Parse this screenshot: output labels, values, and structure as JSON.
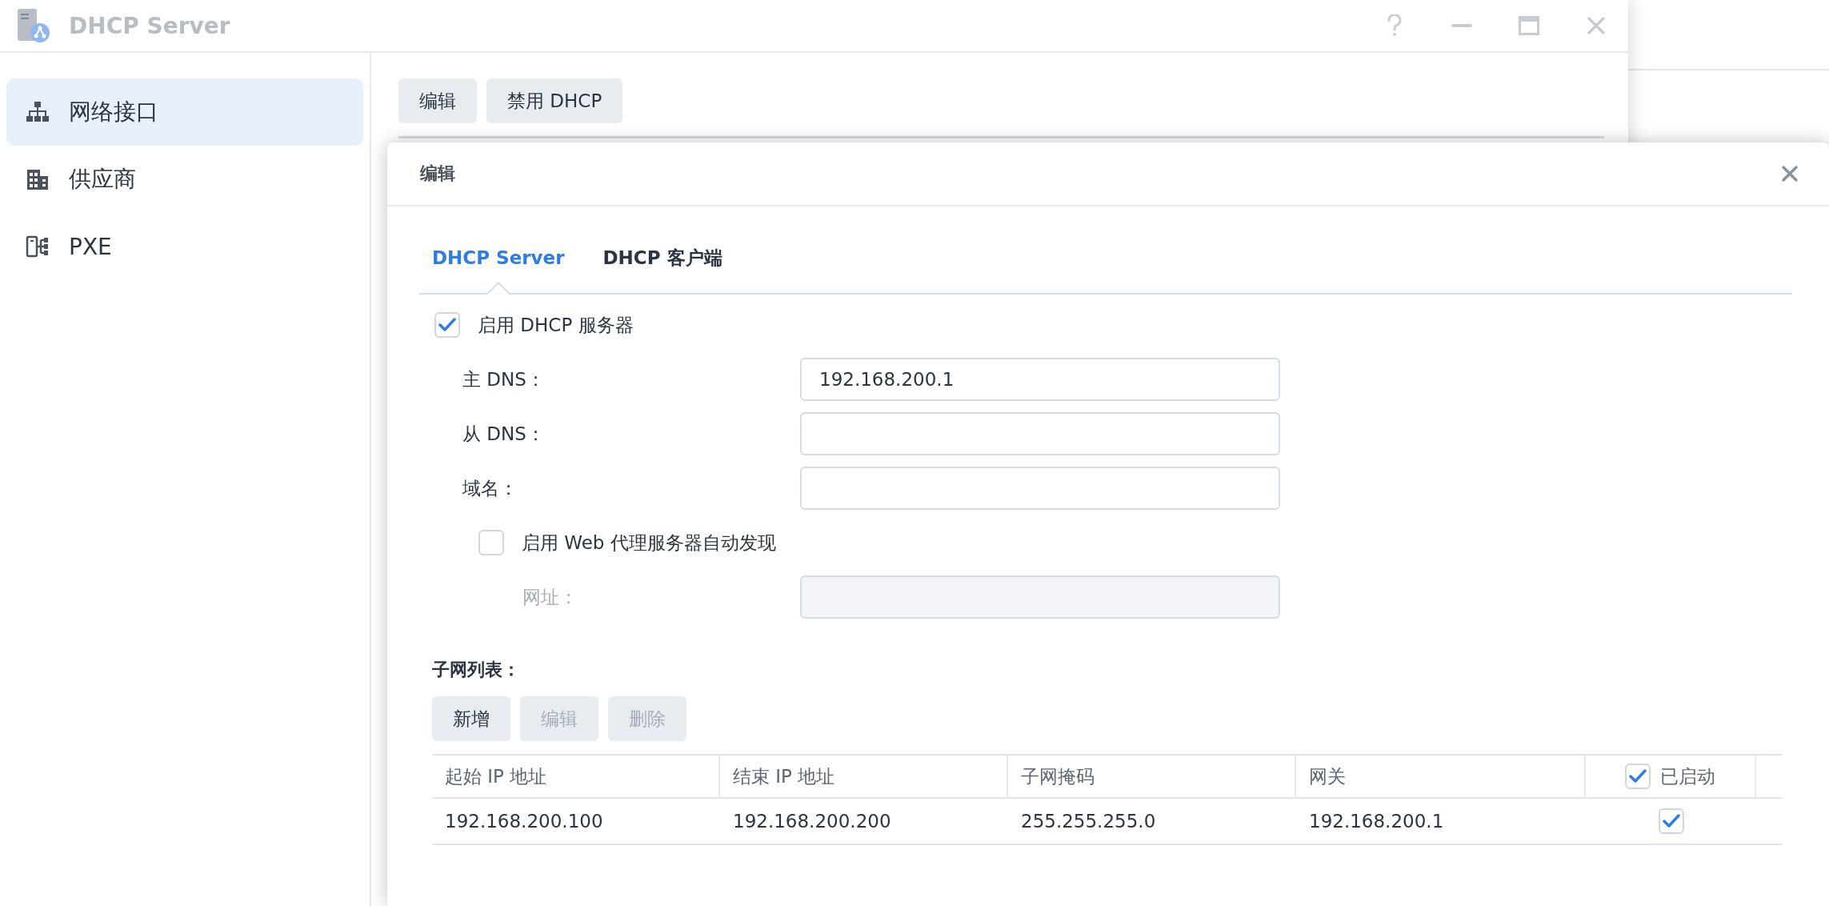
{
  "window": {
    "title": "DHCP Server"
  },
  "sidebar": {
    "items": [
      {
        "label": "网络接口",
        "selected": true
      },
      {
        "label": "供应商",
        "selected": false
      },
      {
        "label": "PXE",
        "selected": false
      }
    ]
  },
  "toolbar": {
    "buttons": [
      "编辑",
      "禁用 DHCP"
    ]
  },
  "dialog": {
    "title": "编辑",
    "tabs": [
      {
        "label": "DHCP Server",
        "selected": true
      },
      {
        "label": "DHCP 客户端",
        "selected": false
      }
    ],
    "enable_server": {
      "label": "启用 DHCP 服务器",
      "checked": true
    },
    "fields": [
      {
        "label": "主 DNS：",
        "value": "192.168.200.1"
      },
      {
        "label": "从 DNS："
      },
      {
        "label": "域名："
      }
    ],
    "proxy": {
      "label": "启用 Web 代理服务器自动发现",
      "checked": false
    },
    "url_field": {
      "label": "网址：",
      "disabled": true
    },
    "subnet": {
      "title": "子网列表：",
      "buttons": [
        {
          "label": "新增",
          "disabled": false
        },
        {
          "label": "编辑",
          "disabled": true
        },
        {
          "label": "删除",
          "disabled": true
        }
      ],
      "columns": [
        {
          "label": "起始 IP 地址"
        },
        {
          "label": "结束 IP 地址"
        },
        {
          "label": "子网掩码"
        },
        {
          "label": "网关"
        },
        {
          "label": "已启动",
          "checked": true
        }
      ],
      "rows": [
        {
          "cells": [
            "192.168.200.100",
            "192.168.200.200",
            "255.255.255.0",
            "192.168.200.1"
          ],
          "enabled": true
        }
      ]
    }
  }
}
